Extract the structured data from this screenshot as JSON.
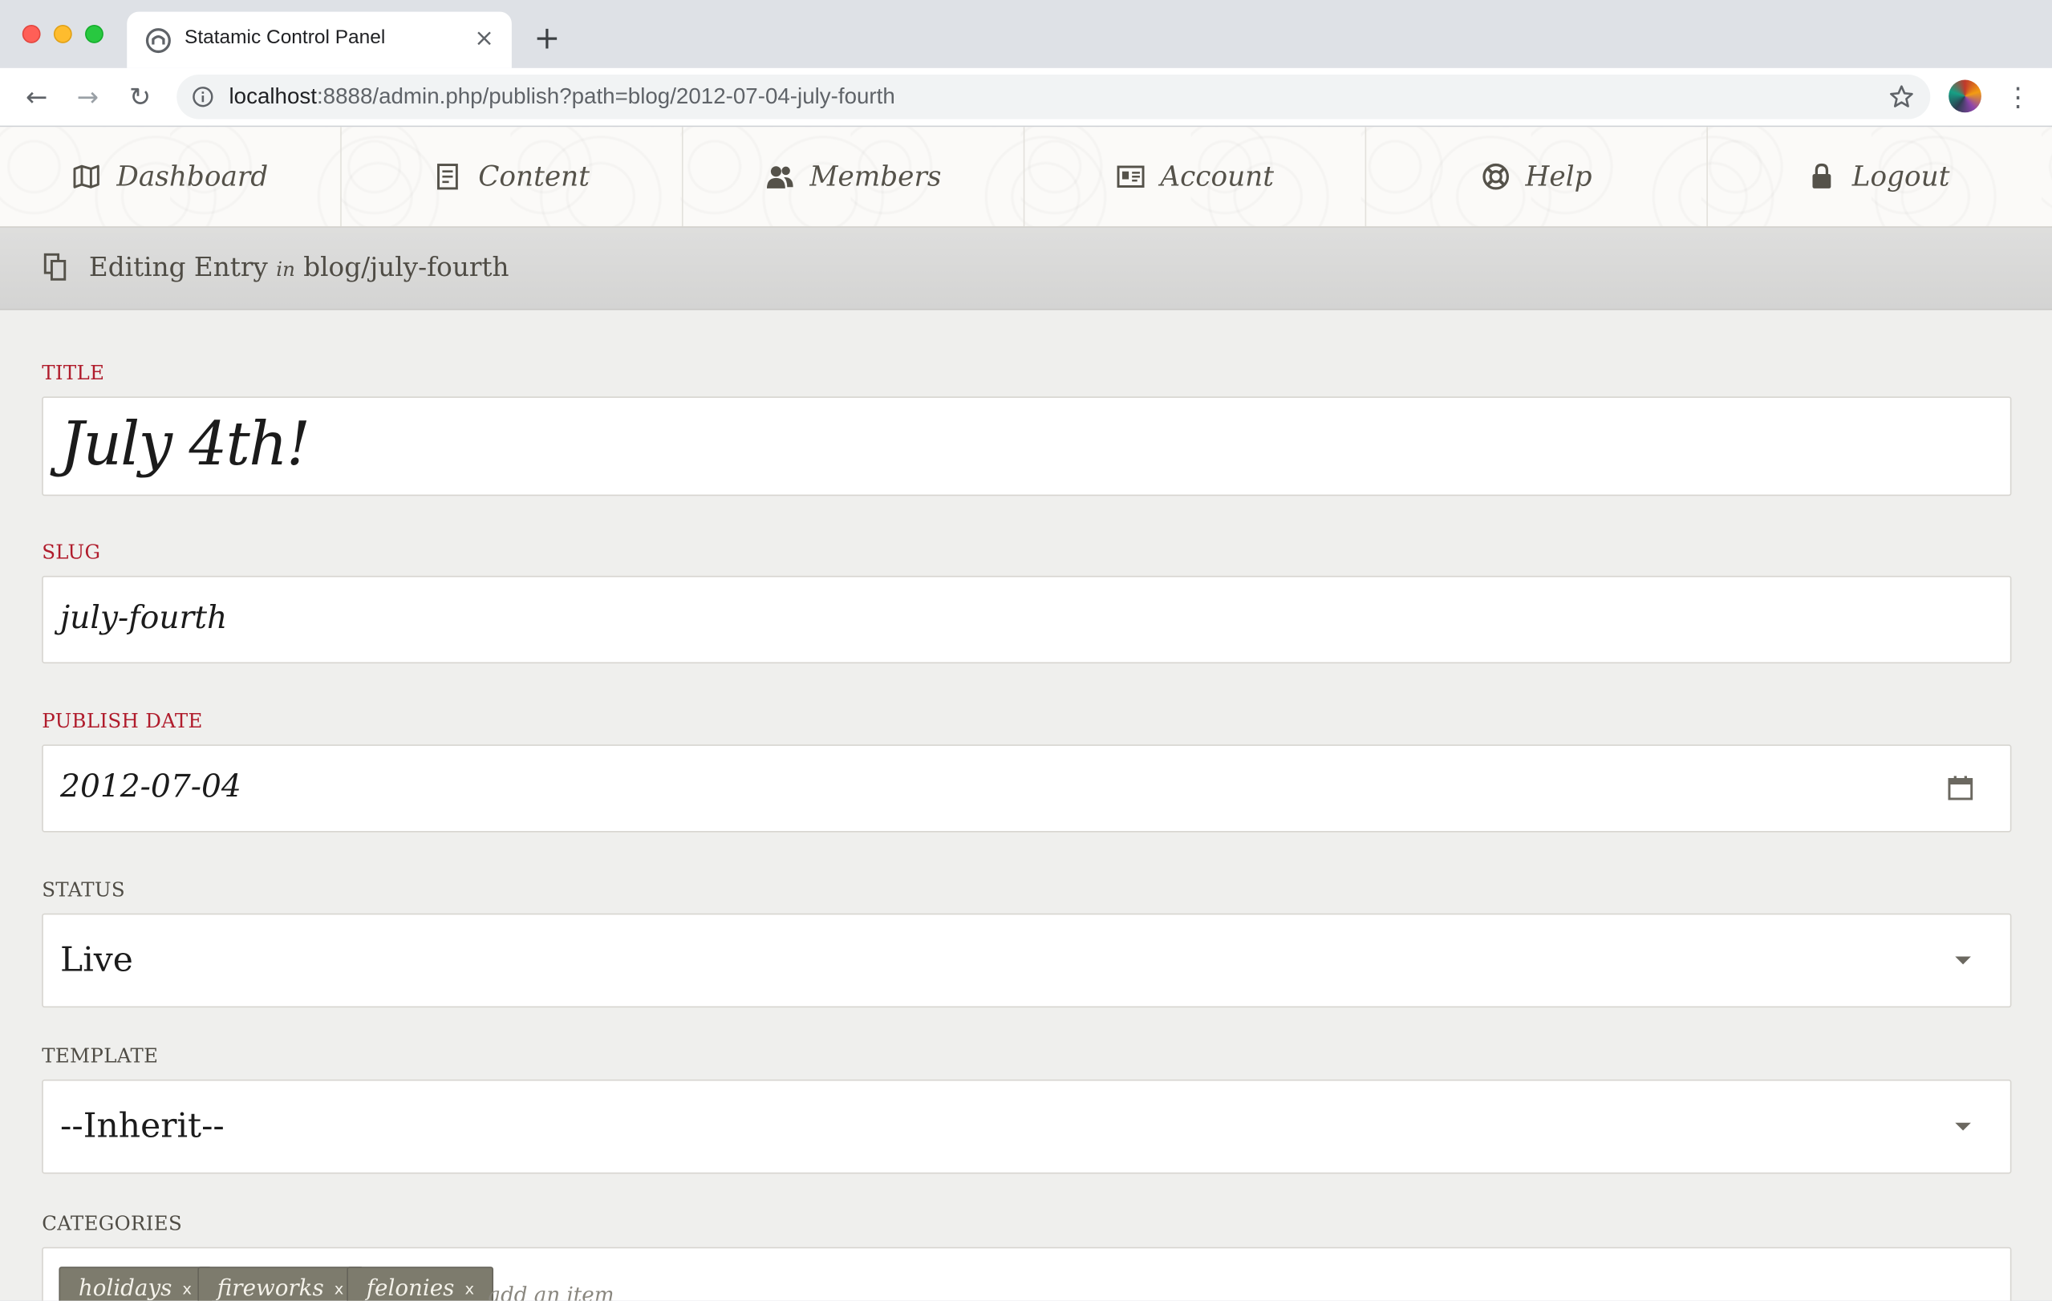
{
  "browser": {
    "tab_title": "Statamic Control Panel",
    "tab_close": "×",
    "new_tab": "+",
    "url_host": "localhost",
    "url_rest": ":8888/admin.php/publish?path=blog/2012-07-04-july-fourth",
    "back": "←",
    "forward": "→",
    "reload": "↻",
    "menu": "⋮"
  },
  "nav": {
    "items": [
      {
        "label": "Dashboard",
        "icon": "map-icon"
      },
      {
        "label": "Content",
        "icon": "document-icon"
      },
      {
        "label": "Members",
        "icon": "members-icon"
      },
      {
        "label": "Account",
        "icon": "id-card-icon"
      },
      {
        "label": "Help",
        "icon": "lifebuoy-icon"
      },
      {
        "label": "Logout",
        "icon": "lock-icon"
      }
    ]
  },
  "entry_bar": {
    "prefix": "Editing Entry",
    "in": "in",
    "path": "blog/july-fourth"
  },
  "form": {
    "title": {
      "label": "TITLE",
      "value": "July 4th!"
    },
    "slug": {
      "label": "SLUG",
      "value": "july-fourth"
    },
    "publish_date": {
      "label": "PUBLISH DATE",
      "value": "2012-07-04"
    },
    "status": {
      "label": "STATUS",
      "value": "Live"
    },
    "template": {
      "label": "TEMPLATE",
      "value": "--Inherit--"
    },
    "categories": {
      "label": "CATEGORIES",
      "tags": [
        "holidays",
        "fireworks",
        "felonies"
      ],
      "tag_remove": "x",
      "placeholder": "add an item"
    }
  },
  "colors": {
    "required_label": "#b01c2c",
    "tag_bg": "#7d7b6d"
  }
}
